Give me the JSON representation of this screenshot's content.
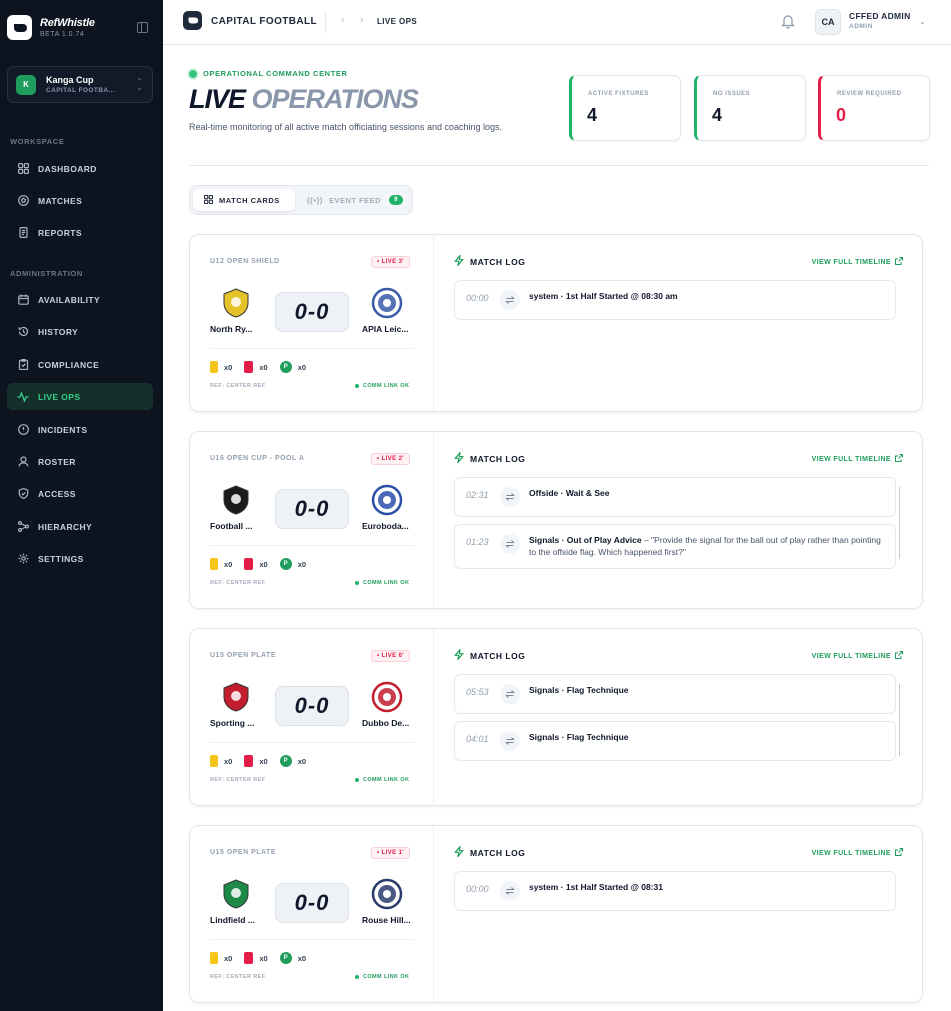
{
  "app": {
    "name": "RefWhistle",
    "version": "BETA 1.0.74"
  },
  "org": {
    "initial": "K",
    "name": "Kanga Cup",
    "sub": "CAPITAL FOOTBA..."
  },
  "sidebar": {
    "sections": [
      {
        "title": "WORKSPACE",
        "items": [
          "DASHBOARD",
          "MATCHES",
          "REPORTS"
        ]
      },
      {
        "title": "ADMINISTRATION",
        "items": [
          "AVAILABILITY",
          "HISTORY",
          "COMPLIANCE",
          "LIVE OPS",
          "INCIDENTS",
          "ROSTER",
          "ACCESS",
          "HIERARCHY",
          "SETTINGS"
        ]
      }
    ],
    "active": "LIVE OPS"
  },
  "topbar": {
    "org_name": "CAPITAL FOOTBALL",
    "breadcrumb": "LIVE OPS",
    "user_initials": "CA",
    "user_name": "CFFED ADMIN",
    "user_role": "ADMIN"
  },
  "header": {
    "tag": "OPERATIONAL COMMAND CENTER",
    "title_1": "LIVE",
    "title_2": "OPERATIONS",
    "subtitle": "Real-time monitoring of all active match officiating sessions and coaching logs."
  },
  "stats": [
    {
      "label": "ACTIVE FIXTURES",
      "value": "4",
      "accent": "#1fb36a"
    },
    {
      "label": "NO ISSUES",
      "value": "4",
      "accent": "#1fb36a"
    },
    {
      "label": "REVIEW REQUIRED",
      "value": "0",
      "accent": "#e11d48"
    }
  ],
  "view_toggle": {
    "cards_label": "MATCH CARDS",
    "feed_label": "EVENT FEED",
    "feed_count": "9",
    "selected": "MATCH CARDS"
  },
  "matches": [
    {
      "competition": "U12 OPEN SHIELD",
      "live": "• LIVE 3'",
      "home": "North Ry...",
      "away": "APIA Leic...",
      "score": "0-0",
      "yellow": "x0",
      "red": "x0",
      "penalty": "x0",
      "ref": "REF: CENTER REF",
      "comm": "COMM LINK OK",
      "log_title": "MATCH LOG",
      "log_link": "VIEW FULL TIMELINE",
      "log": [
        {
          "time": "00:00",
          "type": "system · 1st Half Started @ 08:30 am",
          "quote": ""
        }
      ]
    },
    {
      "competition": "U16 OPEN CUP - POOL A",
      "live": "• LIVE 2'",
      "home": "Football ...",
      "away": "Euroboda...",
      "score": "0-0",
      "yellow": "x0",
      "red": "x0",
      "penalty": "x0",
      "ref": "REF: CENTER REF",
      "comm": "COMM LINK OK",
      "log_title": "MATCH LOG",
      "log_link": "VIEW FULL TIMELINE",
      "log": [
        {
          "time": "02:31",
          "type": "Offside · Wait & See",
          "quote": ""
        },
        {
          "time": "01:23",
          "type": "Signals · Out of Play Advice",
          "quote": " – \"Provide the signal for the ball out of play rather than pointing to the offside flag. Which happened first?\""
        }
      ]
    },
    {
      "competition": "U15 OPEN PLATE",
      "live": "• LIVE 6'",
      "home": "Sporting ...",
      "away": "Dubbo De...",
      "score": "0-0",
      "yellow": "x0",
      "red": "x0",
      "penalty": "x0",
      "ref": "REF: CENTER REF",
      "comm": "COMM LINK OK",
      "log_title": "MATCH LOG",
      "log_link": "VIEW FULL TIMELINE",
      "log": [
        {
          "time": "05:53",
          "type": "Signals · Flag Technique",
          "quote": ""
        },
        {
          "time": "04:01",
          "type": "Signals · Flag Technique",
          "quote": ""
        }
      ]
    },
    {
      "competition": "U15 OPEN PLATE",
      "live": "• LIVE 1'",
      "home": "Lindfield ...",
      "away": "Rouse Hill...",
      "score": "0-0",
      "yellow": "x0",
      "red": "x0",
      "penalty": "x0",
      "ref": "REF: CENTER REF",
      "comm": "COMM LINK OK",
      "log_title": "MATCH LOG",
      "log_link": "VIEW FULL TIMELINE",
      "log": [
        {
          "time": "00:00",
          "type": "system · 1st Half Started @ 08:31",
          "quote": ""
        }
      ]
    }
  ],
  "colors": {
    "sidebar_bg": "#0d1420",
    "accent_green": "#1fb36a",
    "alert_red": "#e11d48",
    "active_nav_bg": "#14302a"
  }
}
